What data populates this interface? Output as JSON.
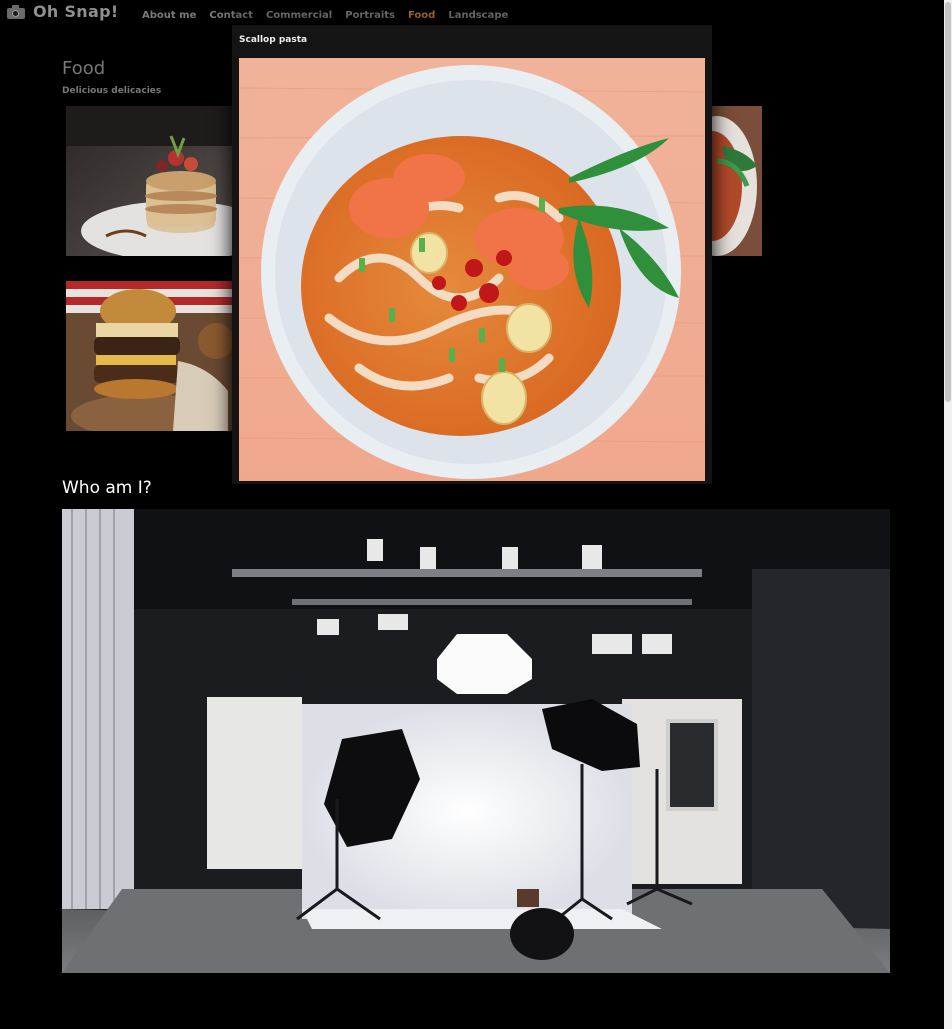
{
  "brand": {
    "name": "Oh Snap!",
    "icon": "camera-icon"
  },
  "nav": {
    "links": [
      {
        "label": "About me",
        "active": false
      },
      {
        "label": "Contact",
        "active": false
      },
      {
        "label": "Commercial",
        "active": false
      },
      {
        "label": "Portraits",
        "active": false
      },
      {
        "label": "Food",
        "active": true
      },
      {
        "label": "Landscape",
        "active": false
      }
    ]
  },
  "gallery": {
    "title": "Food",
    "subtitle": "Delicious delicacies"
  },
  "modal": {
    "title": "Scallop pasta"
  },
  "about": {
    "title": "Who am I?"
  },
  "colors": {
    "background": "#000000",
    "active_link": "#b87335",
    "muted": "#777777"
  }
}
